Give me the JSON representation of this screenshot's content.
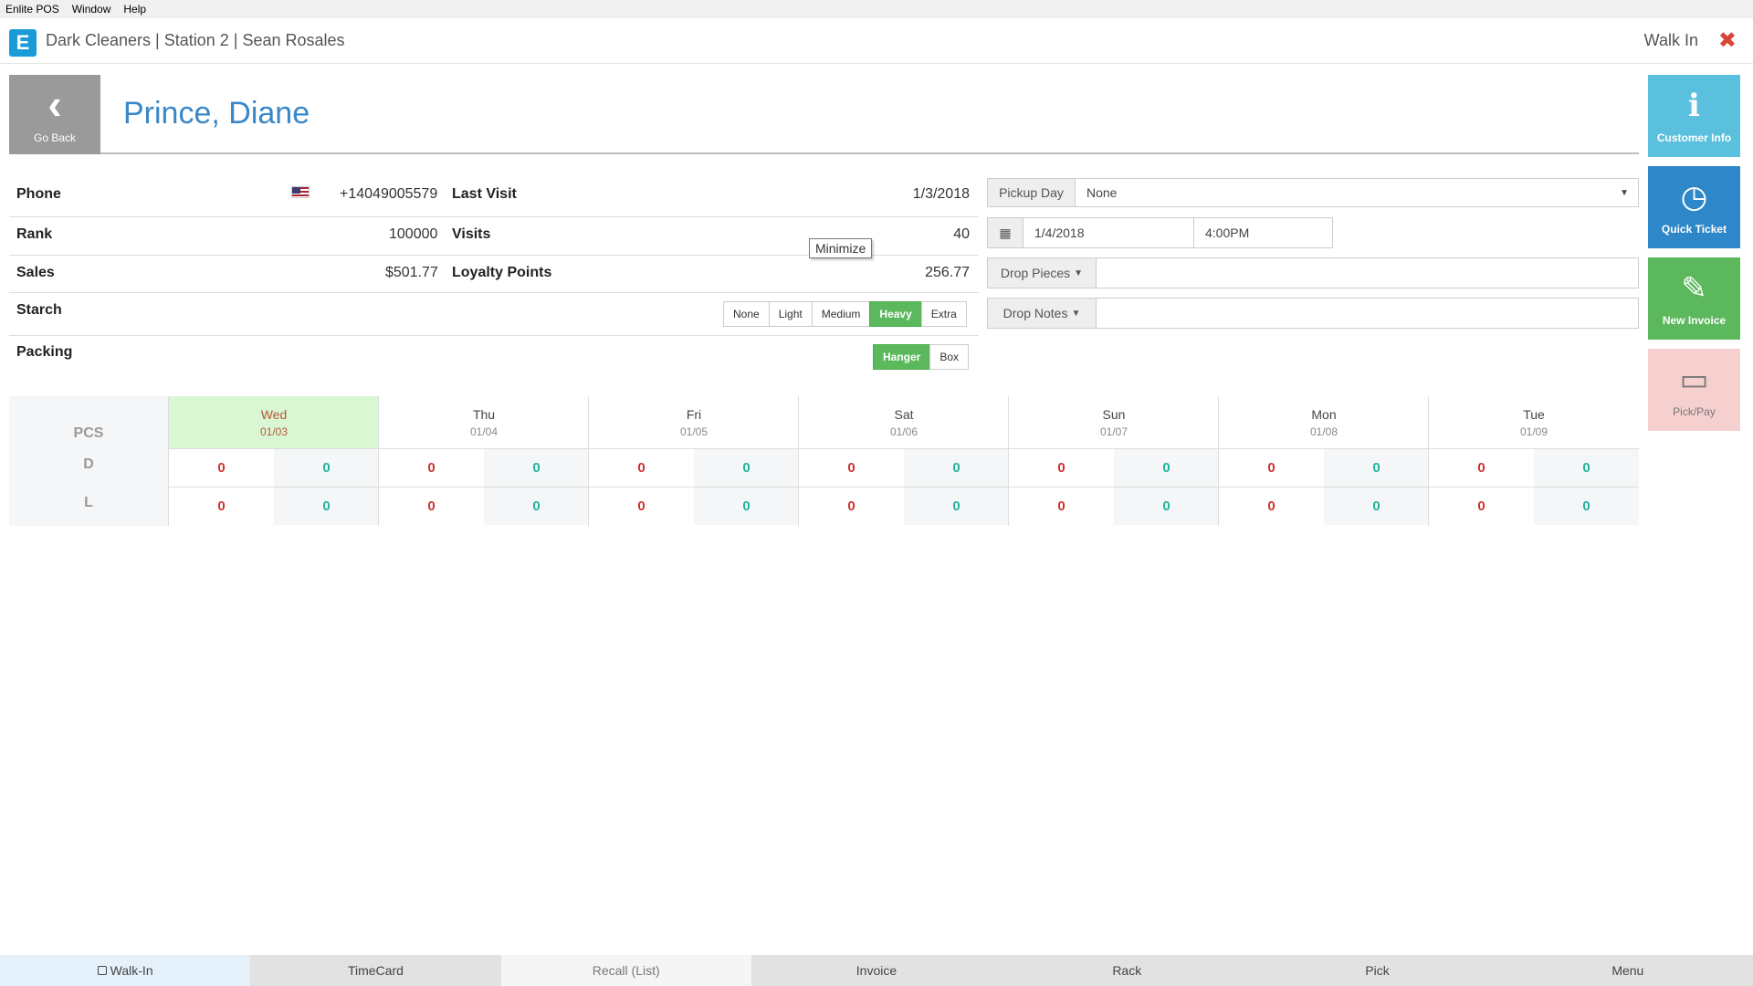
{
  "menubar": {
    "items": [
      "Enlite POS",
      "Window",
      "Help"
    ]
  },
  "header": {
    "logo": "E",
    "title": "Dark Cleaners | Station 2 | Sean Rosales",
    "mode": "Walk In",
    "close_icon": "✖"
  },
  "goback": {
    "label": "Go Back"
  },
  "customer": {
    "name": "Prince, Diane"
  },
  "info": {
    "phone_label": "Phone",
    "phone": "+14049005579",
    "last_visit_label": "Last Visit",
    "last_visit": "1/3/2018",
    "rank_label": "Rank",
    "rank": "100000",
    "visits_label": "Visits",
    "visits": "40",
    "sales_label": "Sales",
    "sales": "$501.77",
    "loyalty_label": "Loyalty Points",
    "loyalty": "256.77",
    "starch_label": "Starch",
    "starch_options": [
      "None",
      "Light",
      "Medium",
      "Heavy",
      "Extra"
    ],
    "starch_selected": "Heavy",
    "packing_label": "Packing",
    "packing_options": [
      "Hanger",
      "Box"
    ],
    "packing_selected": "Hanger"
  },
  "tooltip": "Minimize",
  "form": {
    "pickup_day_label": "Pickup Day",
    "pickup_day_value": "None",
    "date_value": "1/4/2018",
    "time_value": "4:00PM",
    "drop_pieces_label": "Drop Pieces",
    "drop_notes_label": "Drop Notes"
  },
  "actions": {
    "customer_info": "Customer Info",
    "quick_ticket": "Quick Ticket",
    "new_invoice": "New Invoice",
    "pick_pay": "Pick/Pay"
  },
  "schedule": {
    "pcs_label": "PCS",
    "row_labels": [
      "D",
      "L"
    ],
    "days": [
      {
        "name": "Wed",
        "date": "01/03",
        "d": [
          "0",
          "0"
        ],
        "l": [
          "0",
          "0"
        ]
      },
      {
        "name": "Thu",
        "date": "01/04",
        "d": [
          "0",
          "0"
        ],
        "l": [
          "0",
          "0"
        ]
      },
      {
        "name": "Fri",
        "date": "01/05",
        "d": [
          "0",
          "0"
        ],
        "l": [
          "0",
          "0"
        ]
      },
      {
        "name": "Sat",
        "date": "01/06",
        "d": [
          "0",
          "0"
        ],
        "l": [
          "0",
          "0"
        ]
      },
      {
        "name": "Sun",
        "date": "01/07",
        "d": [
          "0",
          "0"
        ],
        "l": [
          "0",
          "0"
        ]
      },
      {
        "name": "Mon",
        "date": "01/08",
        "d": [
          "0",
          "0"
        ],
        "l": [
          "0",
          "0"
        ]
      },
      {
        "name": "Tue",
        "date": "01/09",
        "d": [
          "0",
          "0"
        ],
        "l": [
          "0",
          "0"
        ]
      }
    ]
  },
  "bottomnav": [
    "Walk-In",
    "TimeCard",
    "Recall (List)",
    "Invoice",
    "Rack",
    "Pick",
    "Menu"
  ],
  "colors": {
    "accent": "#3a87c8",
    "green": "#5cb85c",
    "red": "#d0312d",
    "teal": "#21b59b"
  }
}
